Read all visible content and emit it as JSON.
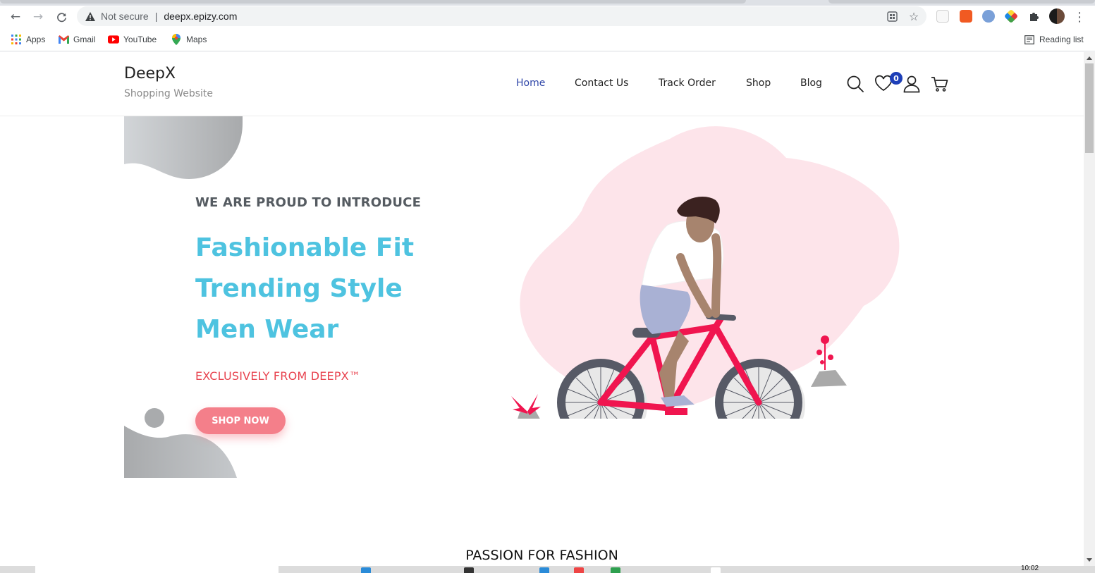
{
  "browser": {
    "security_label": "Not secure",
    "url": "deepx.epizy.com",
    "bookmarks": [
      {
        "label": "Apps",
        "icon": "apps-grid-icon"
      },
      {
        "label": "Gmail",
        "icon": "gmail-icon"
      },
      {
        "label": "YouTube",
        "icon": "youtube-icon"
      },
      {
        "label": "Maps",
        "icon": "maps-icon"
      }
    ],
    "reading_list": "Reading list"
  },
  "site": {
    "logo": "DeepX",
    "tagline": "Shopping Website",
    "nav": [
      {
        "label": "Home",
        "active": true
      },
      {
        "label": "Contact Us",
        "active": false
      },
      {
        "label": "Track Order",
        "active": false
      },
      {
        "label": "Shop",
        "active": false
      },
      {
        "label": "Blog",
        "active": false
      }
    ],
    "wishlist_count": "0"
  },
  "hero": {
    "eyebrow": "WE ARE PROUD TO INTRODUCE",
    "lines": [
      "Fashionable Fit",
      "Trending Style",
      "Men Wear"
    ],
    "subline": "EXCLUSIVELY FROM DEEPX™",
    "cta": "SHOP NOW"
  },
  "section": {
    "title": "PASSION FOR FASHION"
  },
  "taskbar": {
    "time": "10:02"
  },
  "colors": {
    "accent_blue": "#4ec3e0",
    "accent_red": "#e8434f",
    "button_pink": "#f47f8a",
    "nav_active": "#2f46a8",
    "bike": "#f0154f",
    "blob": "#fde4ea"
  }
}
